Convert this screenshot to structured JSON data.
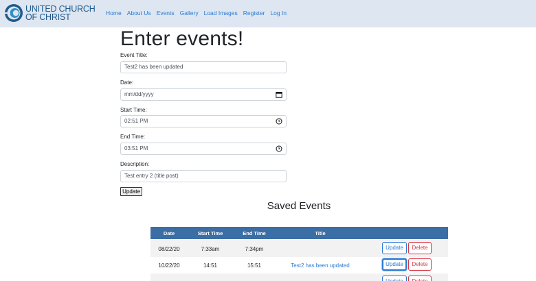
{
  "nav": {
    "logo_line1": "UNITED CHURCH",
    "logo_line2": "OF CHRIST",
    "links": [
      "Home",
      "About Us",
      "Events",
      "Gallery",
      "Load Images",
      "Register",
      "Log In"
    ]
  },
  "form": {
    "heading": "Enter events!",
    "title_label": "Event Title:",
    "title_value": "Test2 has been updated",
    "date_label": "Date:",
    "date_value": "mm/dd/yyyy",
    "start_label": "Start Time:",
    "start_value": "02:51 PM",
    "end_label": "End Time:",
    "end_value": "03:51 PM",
    "desc_label": "Description:",
    "desc_value": "Test entry 2 (title post)",
    "submit_label": "Update"
  },
  "events": {
    "heading": "Saved Events",
    "columns": [
      "Date",
      "Start Time",
      "End Time",
      "Title"
    ],
    "update_label": "Update",
    "delete_label": "Delete",
    "rows": [
      {
        "date": "08/22/20",
        "start": "7:33am",
        "end": "7:34pm",
        "title": ""
      },
      {
        "date": "10/22/20",
        "start": "14:51",
        "end": "15:51",
        "title": "Test2 has been updated"
      },
      {
        "date": "",
        "start": "",
        "end": "",
        "title": ""
      }
    ]
  },
  "colors": {
    "navbar_bg": "#dde6f1",
    "table_header": "#3b6ea5",
    "link": "#2a7bd5",
    "danger": "#dc3545"
  }
}
